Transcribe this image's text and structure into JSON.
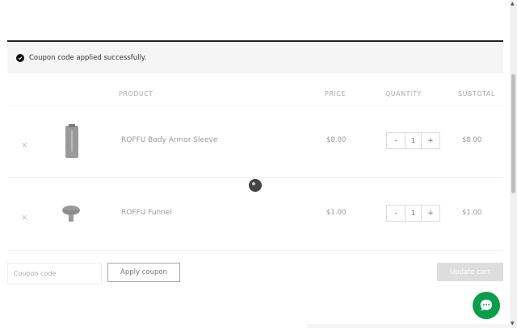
{
  "notice": {
    "message": "Coupon code applied successfully."
  },
  "table": {
    "headers": {
      "product": "PRODUCT",
      "price": "PRICE",
      "quantity": "QUANTITY",
      "subtotal": "SUBTOTAL"
    },
    "rows": [
      {
        "remove": "×",
        "name": "ROFFU Body Armor Sleeve",
        "price": "$8.00",
        "qty": "1",
        "subtotal": "$8.00"
      },
      {
        "remove": "×",
        "name": "ROFFU Funnel",
        "price": "$1.00",
        "qty": "1",
        "subtotal": "$1.00"
      }
    ],
    "minus": "-",
    "plus": "+"
  },
  "coupon": {
    "placeholder": "Coupon code",
    "apply_label": "Apply coupon"
  },
  "update_label": "Update cart",
  "colors": {
    "accent": "#0b9e4a",
    "notice_bg": "#f5f5f5",
    "update_bg": "#dddddd"
  }
}
